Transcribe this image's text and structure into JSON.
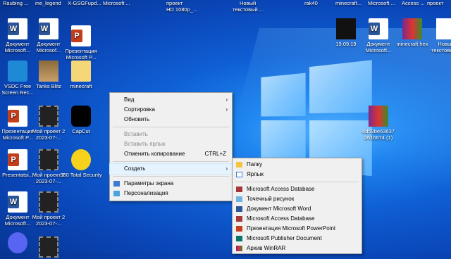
{
  "top_cut_labels": [
    "Raubing ...",
    "ine_legend",
    "X-GSGFupd...",
    "Microsoft ...",
    "проект",
    "HD 1080p_...",
    "Новый",
    "текстовый ...",
    "rak40",
    "minecraft...",
    "Microsoft ...",
    "Access ...",
    "проект"
  ],
  "desktop": {
    "icons": [
      {
        "label": "Документ Microsoft...",
        "type": "word"
      },
      {
        "label": "Документ Microsof...",
        "type": "word"
      },
      {
        "label": "Презентация Microsoft P...",
        "type": "ppt"
      },
      {
        "label": "VSDC Free Screen Rec...",
        "type": "vsdc"
      },
      {
        "label": "Tanks Blitz",
        "type": "photo"
      },
      {
        "label": "minecraft",
        "type": "folder"
      },
      {
        "label": "Презентация Microsoft P...",
        "type": "ppt"
      },
      {
        "label": "Мой проект 2 2023-07-...",
        "type": "film"
      },
      {
        "label": "CapCut",
        "type": "capcut"
      },
      {
        "label": "Presentatsi...",
        "type": "ppt"
      },
      {
        "label": "Мой проект 2 2023-07-...",
        "type": "film"
      },
      {
        "label": "360 Total Security",
        "type": "plus"
      },
      {
        "label": "Документ Microsoft...",
        "type": "word"
      },
      {
        "label": "Мой проект 2 2023-07-...",
        "type": "film"
      },
      {
        "label": "19.09.19",
        "type": "xray"
      },
      {
        "label": "Документ Microsoft...",
        "type": "word"
      },
      {
        "label": "minecraft hex",
        "type": "rar"
      },
      {
        "label": "Новый текстовый...",
        "type": "doc"
      },
      {
        "label": "6d59be63637 2616674 (1)",
        "type": "rar"
      },
      {
        "label": "",
        "type": "discord"
      },
      {
        "label": "",
        "type": "film"
      }
    ]
  },
  "context_menu": {
    "items": [
      {
        "label": "Вид",
        "arrow": "›"
      },
      {
        "label": "Сортировка",
        "arrow": "›"
      },
      {
        "label": "Обновить"
      },
      {
        "label": "Вставить"
      },
      {
        "label": "Вставить ярлык"
      },
      {
        "label": "Отменить копирование",
        "shortcut": "CTRL+Z"
      },
      {
        "label": "Создать",
        "arrow": "›"
      },
      {
        "label": "Параметры экрана"
      },
      {
        "label": "Персонализация"
      }
    ]
  },
  "submenu": {
    "items": [
      {
        "label": "Папку"
      },
      {
        "label": "Ярлык"
      },
      {
        "label": "Microsoft Access Database"
      },
      {
        "label": "Точечный рисунок"
      },
      {
        "label": "Документ Microsoft Word"
      },
      {
        "label": "Microsoft Access Database"
      },
      {
        "label": "Презентация Microsoft PowerPoint"
      },
      {
        "label": "Microsoft Publisher Document"
      },
      {
        "label": "Архив WinRAR"
      }
    ]
  },
  "colors": {
    "desktop_blue": "#0f5fd4",
    "menu_bg": "#f0f0f0",
    "hover": "#e5f3ff"
  }
}
